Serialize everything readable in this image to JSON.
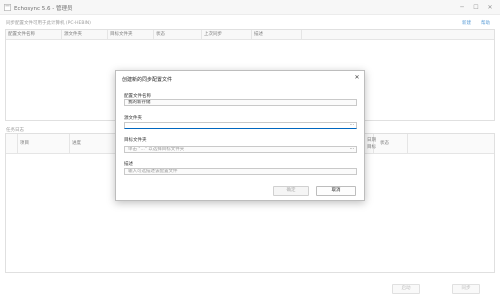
{
  "window": {
    "title": "Echosync 5.6 - 管理员",
    "min_icon": "minimize-icon",
    "max_icon": "maximize-icon",
    "close_icon": "close-icon"
  },
  "header": {
    "section_title": "同步配置文件可用于此计算机 (PC-HEBIN)",
    "new_link": "新建",
    "help_link": "帮助"
  },
  "profile_table": {
    "columns": [
      "配置文件名称",
      "源文件夹",
      "目标文件夹",
      "状态",
      "上次同步",
      "描述"
    ]
  },
  "log": {
    "label": "任务日志",
    "columns": [
      "项目",
      "进度",
      "日期",
      "目标",
      "状态"
    ]
  },
  "footer": {
    "start_label": "启动",
    "sync_label": "同步"
  },
  "dialog": {
    "title": "创建新的同步配置文件",
    "close_icon": "close-icon",
    "name_label": "配置文件名称",
    "name_value": "我的新存储",
    "source_label": "源文件夹",
    "source_value": "",
    "browse_glyph": "···",
    "target_label": "目标文件夹",
    "target_placeholder": "单击 \"...\" 以选择目标文件夹",
    "desc_label": "描述",
    "desc_placeholder": "输入可选描述该配置文件",
    "ok_label": "确定",
    "cancel_label": "取消"
  },
  "colors": {
    "accent": "#0067c0",
    "dialog_bg": "#ffffff",
    "window_bg": "#ffffff"
  }
}
